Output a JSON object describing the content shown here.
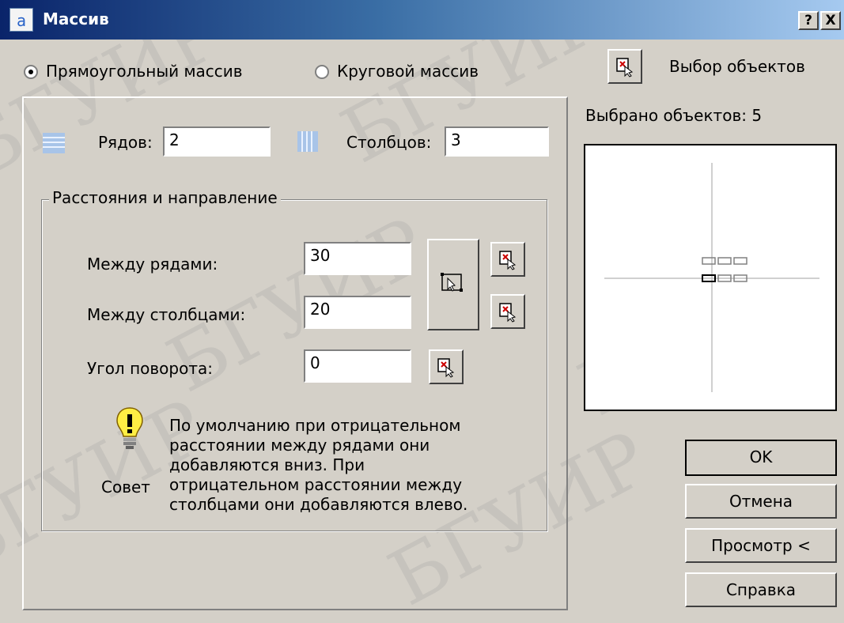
{
  "window": {
    "title": "Массив",
    "help_button": "?",
    "close_button": "X"
  },
  "mode": {
    "rect_label": "Прямоугольный массив",
    "polar_label": "Круговой массив",
    "selected": "rect"
  },
  "select_objects": {
    "label": "Выбор объектов",
    "count_text": "Выбрано объектов: 5"
  },
  "grid": {
    "rows_label": "Рядов:",
    "rows_value": "2",
    "cols_label": "Столбцов:",
    "cols_value": "3"
  },
  "offset_group": {
    "title": "Расстояния и направление",
    "row_offset_label": "Между рядами:",
    "row_offset_value": "30",
    "col_offset_label": "Между столбцами:",
    "col_offset_value": "20",
    "angle_label": "Угол поворота:",
    "angle_value": "0"
  },
  "tip": {
    "label": "Совет",
    "lines": [
      "По умолчанию при отрицательном",
      "расстоянии между рядами они",
      "добавляются вниз. При",
      "отрицательном расстоянии между",
      "столбцами они добавляются влево."
    ]
  },
  "buttons": {
    "ok": "OK",
    "cancel": "Отмена",
    "preview": "Просмотр <",
    "help": "Справка"
  },
  "watermark": "БГУИР",
  "colors": {
    "dialog_bg": "#d4d0c8",
    "title_start": "#0a246a",
    "title_end": "#a6caf0",
    "pick_red": "#cc0000"
  }
}
